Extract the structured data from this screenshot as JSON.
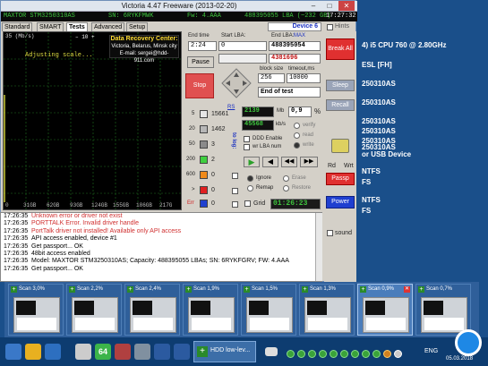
{
  "window": {
    "title": "Victoria 4.47  Freeware (2013-02-20)",
    "min": "–",
    "max": "□",
    "close": "✕"
  },
  "infobar": {
    "model": "MAXTOR STM3250310AS",
    "serial": "SN: 6RYKFMWK",
    "firmware": "Fw: 4.AAA",
    "lba": "488395055 LBA (~232 GB)",
    "time": "17:27:32"
  },
  "tabs": [
    "Standard",
    "SMART",
    "Tests",
    "Advanced",
    "Setup"
  ],
  "graph": {
    "unit": "35 (Mb/s)",
    "status": "Adjusting scale...",
    "top_controls": "–  10  +",
    "drc_title": "Data Recovery Center:",
    "drc_line1": "Victoria, Belarus, Minsk city",
    "drc_line2": "E-mail: sergei@hdd-911.com",
    "xticks": [
      "0",
      "31GB",
      "62GB",
      "93GB",
      "124GB",
      "155GB",
      "186GB",
      "217G"
    ]
  },
  "controls": {
    "end_time_label": "End time",
    "end_time_value": "2:24",
    "start_lba_label": "Start LBA:",
    "start_lba_value": "0",
    "end_lba_label": "End LBA:",
    "max_label": "MAX",
    "end_lba_value": "488395054",
    "cur_lba_value": "4381696",
    "pause": "Pause",
    "stop": "Stop",
    "block_size_label": "block size",
    "block_size_value": "256",
    "timeout_label": "timeout,ms",
    "timeout_value": "10000",
    "end_of_test": "End of test",
    "device": "Device 6",
    "hints": "Hints"
  },
  "progress": {
    "rs": "RS",
    "mb": "2139",
    "mb_unit": "Mb",
    "percent": "0,9",
    "percent_unit": "%",
    "speed": "45568",
    "speed_unit": "kb/s",
    "verify": "verify",
    "read": "read",
    "write": "write",
    "ddd": "DDD Enable",
    "wrlba": "wr LBA num",
    "to_log": "to log:"
  },
  "blocks": [
    {
      "ms": "5",
      "count": "15661",
      "color": "#e6e6e6"
    },
    {
      "ms": "20",
      "count": "1462",
      "color": "#b7b7b7"
    },
    {
      "ms": "50",
      "count": "3",
      "color": "#8a8a8a"
    },
    {
      "ms": "200",
      "count": "2",
      "color": "#3fcf3f"
    },
    {
      "ms": "600",
      "count": "0",
      "color": "#f08a1a"
    },
    {
      "ms": ">",
      "count": "0",
      "color": "#e02020"
    },
    {
      "ms": "Err",
      "count": "0",
      "color": "#2040d0"
    }
  ],
  "mode": {
    "ignore": "Ignore",
    "erase": "Erase",
    "remap": "Remap",
    "restore": "Restore",
    "grid": "Grid",
    "timer": "01:26:23"
  },
  "right_buttons": {
    "break_all": "Break All",
    "sleep": "Sleep",
    "recall": "Recall",
    "rd": "Rd",
    "wrt": "Wrt",
    "passp": "Passp",
    "power": "Power",
    "sound": "sound"
  },
  "log": [
    {
      "time": "17:26:35",
      "text": "Unknown error or driver not exist",
      "color": "#d03030"
    },
    {
      "time": "17:26:35",
      "text": "PORTTALK Error. Invalid driver handle",
      "color": "#d03030"
    },
    {
      "time": "17:26:35",
      "text": "PortTalk driver not installed! Available only API access",
      "color": "#d03030"
    },
    {
      "time": "17:26:35",
      "text": "API access enabled, device #1",
      "color": "#000000"
    },
    {
      "time": "17:26:35",
      "text": "Get passport... OK",
      "color": "#000000"
    },
    {
      "time": "17:26:35",
      "text": "48bit access enabled",
      "color": "#000000"
    },
    {
      "time": "17:26:35",
      "text": "Model: MAXTOR STM3250310AS; Capacity: 488395055 LBAs; SN: 6RYKFGRV; FW: 4.AAA",
      "color": "#000000"
    },
    {
      "time": "17:26:35",
      "text": "Get passport... OK",
      "color": "#000000"
    }
  ],
  "background_text": [
    "4) i5 CPU       760  @ 2.80GHz",
    "ESL [FH]",
    "250310AS",
    "250310AS",
    "250310AS",
    "250310AS",
    "250310AS",
    "250310AS",
    "or USB Device",
    "NTFS",
    "FS",
    "NTFS",
    "FS"
  ],
  "thumbnails": [
    "Scan 3,0%",
    "Scan 2,2%",
    "Scan 2,4%",
    "Scan 1,9%",
    "Scan 1,5%",
    "Scan 1,3%",
    "Scan 0,9%",
    "Scan 0,7%"
  ],
  "taskbar": {
    "active_task": "HDD low-lev...",
    "lang": "ENG",
    "date": "05.03.2018"
  }
}
